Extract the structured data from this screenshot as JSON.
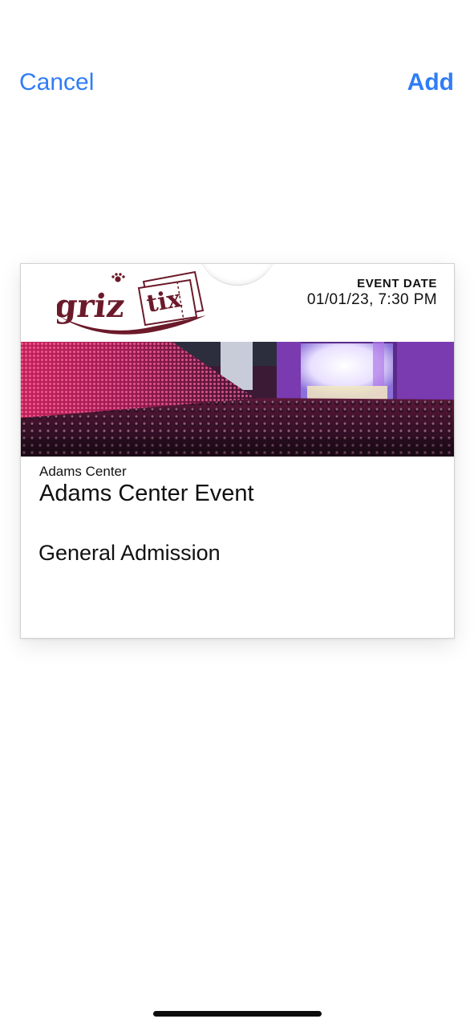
{
  "nav": {
    "cancel_label": "Cancel",
    "add_label": "Add"
  },
  "pass": {
    "logo": {
      "text_griz": "griz",
      "text_tix": "tix",
      "brand_color": "#6b1a2a"
    },
    "event_date_label": "EVENT DATE",
    "event_date_value": "01/01/23, 7:30 PM",
    "strip_image": "concert-arena-crowd-image",
    "venue": "Adams Center",
    "event_name": "Adams Center Event",
    "admission": "General Admission"
  },
  "colors": {
    "accent": "#2f7df6",
    "text": "#111111",
    "background": "#ffffff"
  }
}
